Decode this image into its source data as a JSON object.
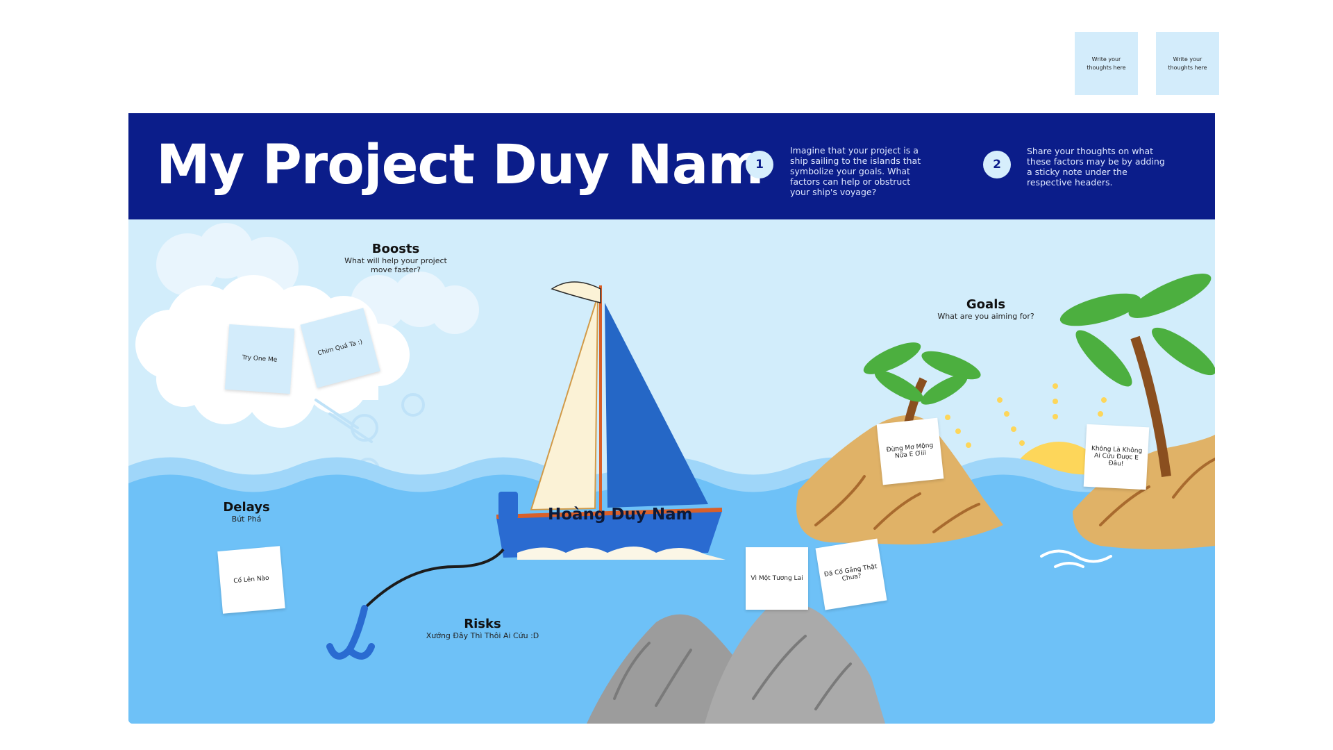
{
  "top_notes": [
    {
      "text": "Write your thoughts here"
    },
    {
      "text": "Write your thoughts here"
    }
  ],
  "header": {
    "title": "My Project Duy Nam",
    "steps": [
      {
        "number": "1",
        "text": "Imagine that your project is a ship sailing to the islands that symbolize your goals. What factors can help or obstruct your ship's voyage?"
      },
      {
        "number": "2",
        "text": "Share your thoughts on what these factors may be by adding a sticky note under the respective headers."
      }
    ]
  },
  "sections": {
    "boosts": {
      "title": "Boosts",
      "subtitle": "What will help your project move faster?"
    },
    "goals": {
      "title": "Goals",
      "subtitle": "What are you aiming for?"
    },
    "delays": {
      "title": "Delays",
      "subtitle": "Bứt Phá"
    },
    "risks": {
      "title": "Risks",
      "subtitle": "Xướng Đây Thì Thôi Ai Cứu :D"
    }
  },
  "boat_label": "Hoàng Duy Nam",
  "stickies": [
    {
      "text": "Try One Me"
    },
    {
      "text": "Chim Quá Ta :)"
    },
    {
      "text": "Đừng Mơ Mộng Nữa E Ơiii"
    },
    {
      "text": "Không Là Không Ai Cứu Được E Đâu!"
    },
    {
      "text": "Cố Lên Nào"
    },
    {
      "text": "Vì Một Tương Lai"
    },
    {
      "text": "Đã Cố Gắng Thật Chưa?"
    }
  ],
  "colors": {
    "header": "#0b1d8a",
    "sky": "#d2edfb",
    "sea": "#6ec1f7",
    "sail_blue": "#2567c6",
    "sand": "#e0b267",
    "rock": "#9c9c9c",
    "sun": "#fdd65a"
  }
}
